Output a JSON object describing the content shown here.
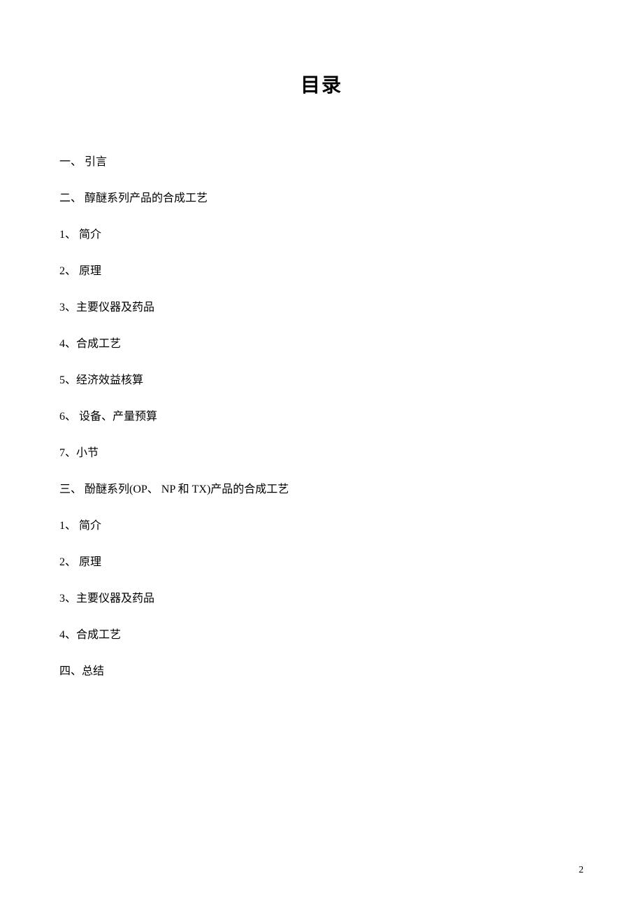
{
  "title": "目录",
  "toc": {
    "items": [
      "一、 引言",
      "二、 醇醚系列产品的合成工艺",
      "1、 简介",
      "2、 原理",
      "3、主要仪器及药品",
      "4、合成工艺",
      "5、经济效益核算",
      "6、 设备、产量预算",
      "7、小节",
      "三、 酚醚系列(OP、 NP 和 TX)产品的合成工艺",
      "1、 简介",
      "2、 原理",
      "3、主要仪器及药品",
      "4、合成工艺",
      "四、总结"
    ]
  },
  "pageNumber": "2"
}
